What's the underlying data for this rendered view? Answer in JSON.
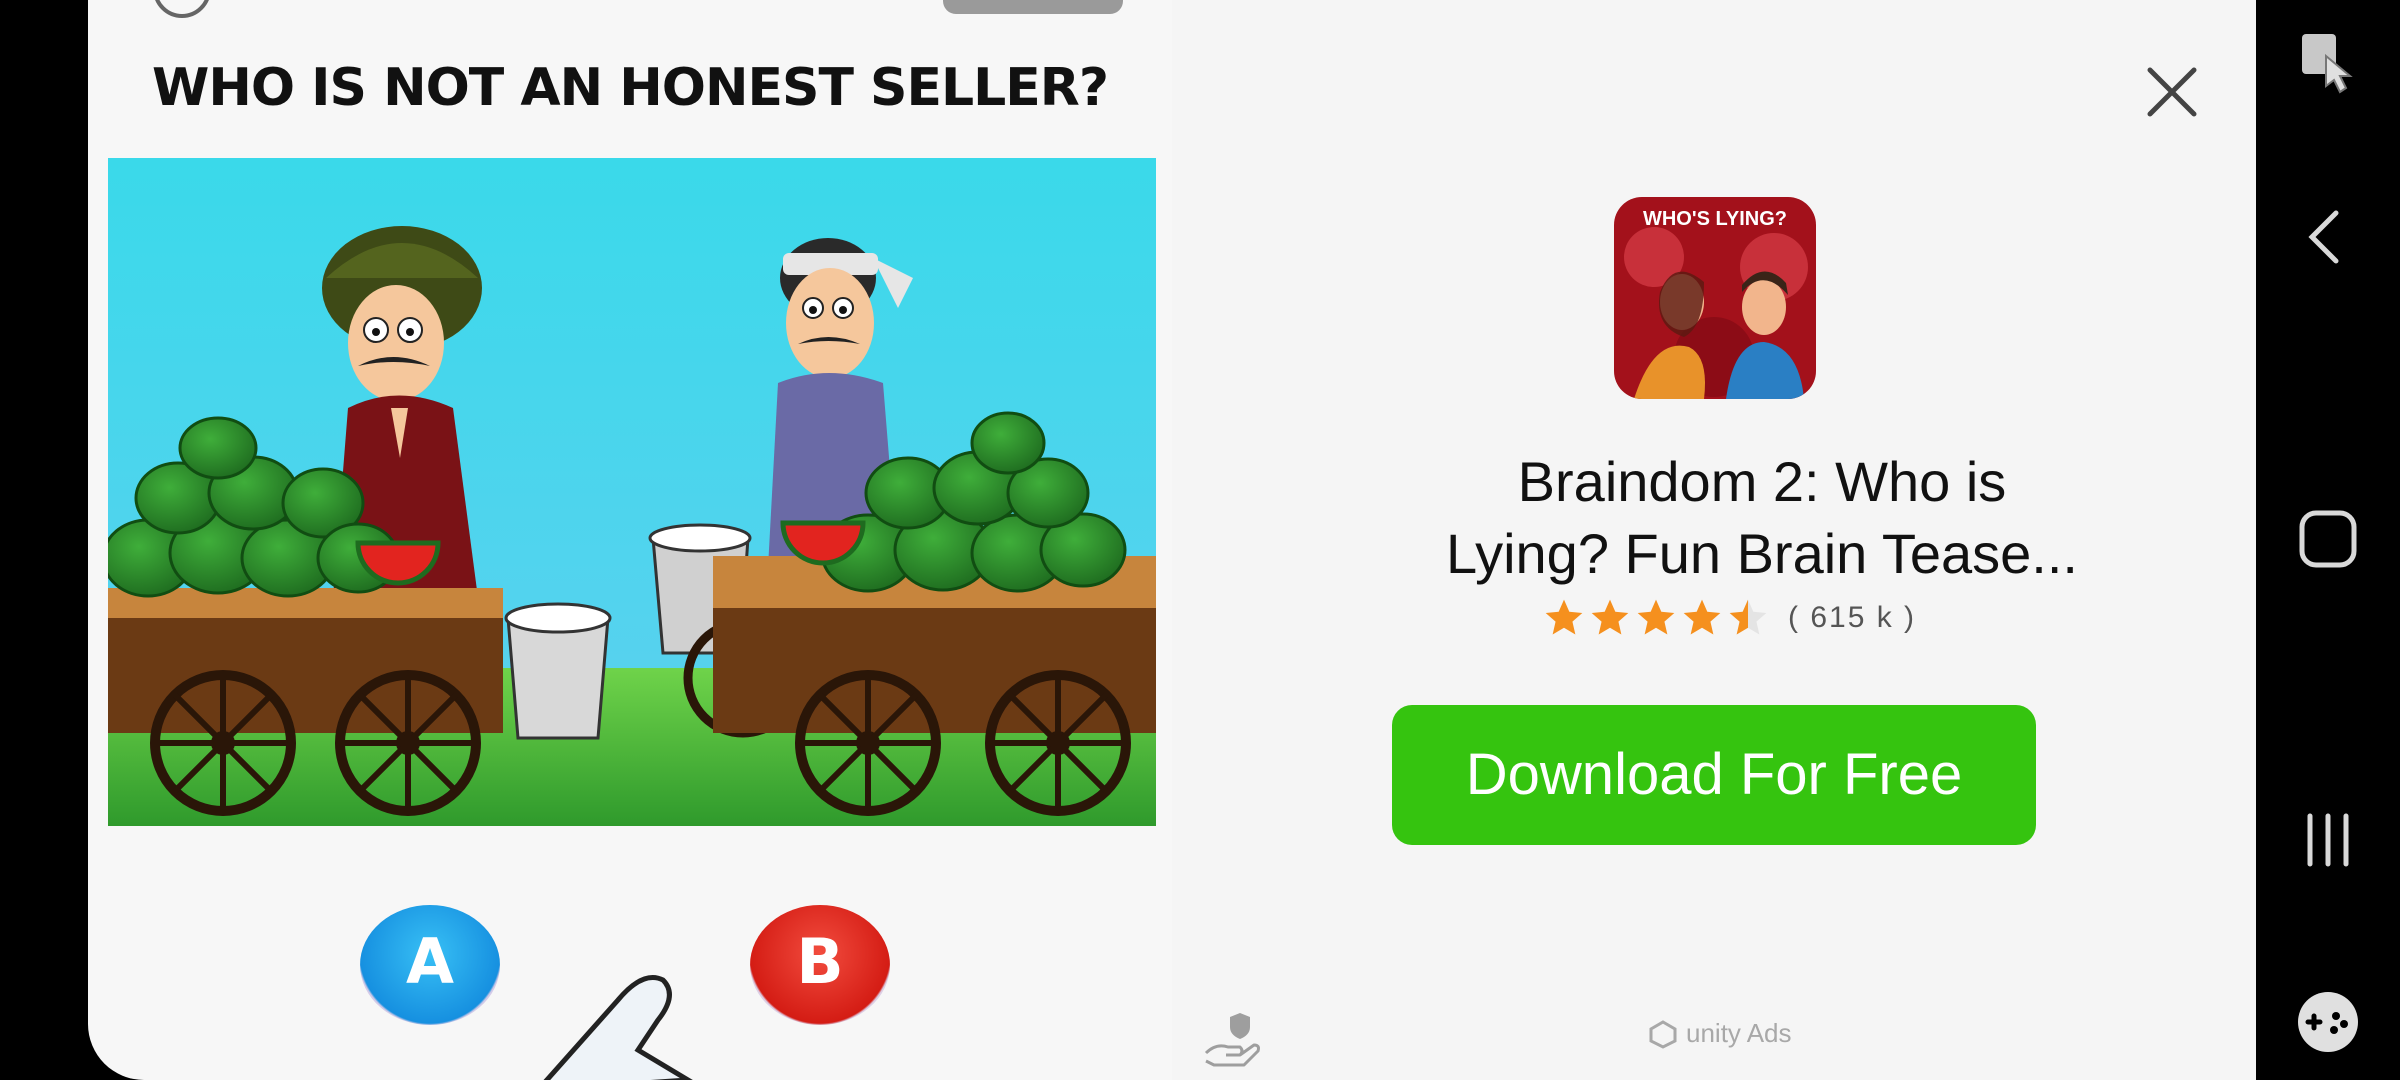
{
  "game": {
    "question": "WHO IS NOT AN HONEST SELLER?",
    "options": [
      "A",
      "B"
    ]
  },
  "ad": {
    "app_icon_text": "WHO'S LYING?",
    "app_title_line1": "Braindom 2: Who is",
    "app_title_line2": "Lying? Fun Brain Tease...",
    "rating_stars": 4.5,
    "rating_count": "( 615 k )",
    "download_label": "Download For Free",
    "network": "unity Ads",
    "colors": {
      "download": "#35c40f",
      "star": "#f5901e"
    }
  },
  "system_nav": {
    "icons": [
      "screen-assist-icon",
      "back-icon",
      "home-icon",
      "recents-icon",
      "game-launcher-icon"
    ]
  }
}
